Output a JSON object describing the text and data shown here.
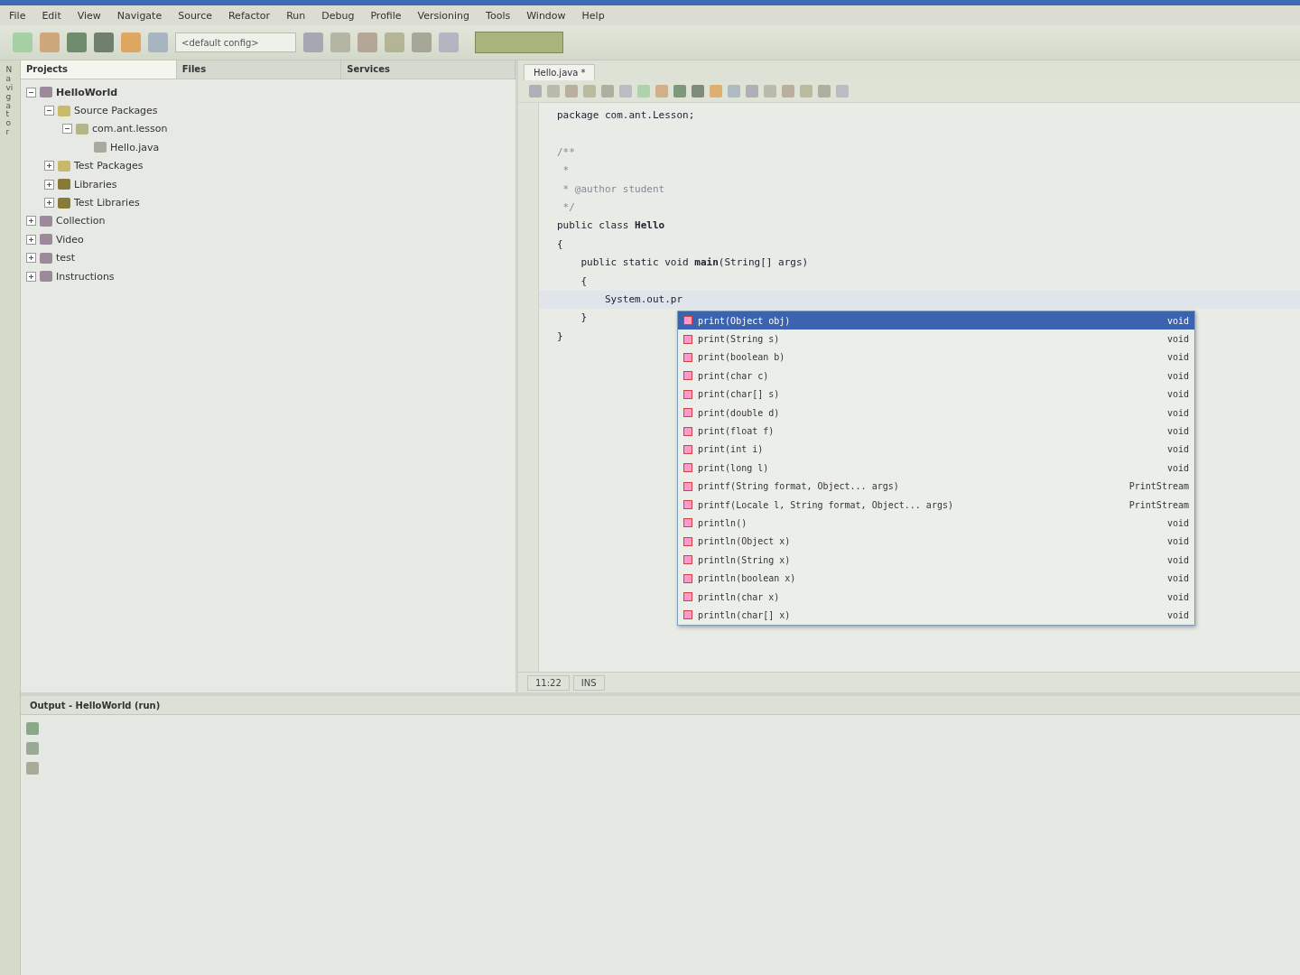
{
  "menu": [
    "File",
    "Edit",
    "View",
    "Navigate",
    "Source",
    "Refactor",
    "Run",
    "Debug",
    "Profile",
    "Versioning",
    "Tools",
    "Window",
    "Help"
  ],
  "toolbar": {
    "config": "<default config>"
  },
  "side_strip": {
    "label": "Navigator"
  },
  "projects_panel": {
    "tabs": [
      {
        "label": "Projects",
        "selected": true
      },
      {
        "label": "Files",
        "selected": false
      },
      {
        "label": "Services",
        "selected": false
      }
    ],
    "tree": [
      {
        "label": "HelloWorld",
        "kind": "project",
        "expanded": true,
        "bold": true,
        "children": [
          {
            "label": "Source Packages",
            "kind": "folder",
            "expanded": true,
            "children": [
              {
                "label": "com.ant.lesson",
                "kind": "package",
                "expanded": true,
                "children": [
                  {
                    "label": "Hello.java",
                    "kind": "file"
                  }
                ]
              }
            ]
          },
          {
            "label": "Test Packages",
            "kind": "folder",
            "expanded": false
          },
          {
            "label": "Libraries",
            "kind": "library",
            "expanded": false
          },
          {
            "label": "Test Libraries",
            "kind": "library",
            "expanded": false
          }
        ]
      },
      {
        "label": "Collection",
        "kind": "project",
        "expanded": false
      },
      {
        "label": "Video",
        "kind": "project",
        "expanded": false
      },
      {
        "label": "test",
        "kind": "project",
        "expanded": false
      },
      {
        "label": "Instructions",
        "kind": "project",
        "expanded": false
      }
    ]
  },
  "editor": {
    "tab": "Hello.java *",
    "lines": [
      {
        "text": "package com.ant.Lesson;",
        "kind": "code"
      },
      {
        "kind": "blank"
      },
      {
        "text": "/**",
        "kind": "comment"
      },
      {
        "text": " *",
        "kind": "comment"
      },
      {
        "text": " * @author student",
        "kind": "comment"
      },
      {
        "text": " */",
        "kind": "comment"
      },
      {
        "text": "public class **Hello**",
        "kind": "code"
      },
      {
        "text": "{",
        "kind": "code"
      },
      {
        "text": "    public static void **main**(String[] args)",
        "kind": "code"
      },
      {
        "text": "    {",
        "kind": "code"
      },
      {
        "text": "        System.out.pr",
        "kind": "current"
      },
      {
        "text": "    }",
        "kind": "code"
      },
      {
        "text": "}",
        "kind": "code"
      }
    ],
    "status": [
      "11:22",
      "INS"
    ]
  },
  "completion": [
    {
      "signature": "print(Object obj)",
      "type": "void",
      "selected": true
    },
    {
      "signature": "print(String s)",
      "type": "void",
      "selected": false
    },
    {
      "signature": "print(boolean b)",
      "type": "void",
      "selected": false
    },
    {
      "signature": "print(char c)",
      "type": "void",
      "selected": false
    },
    {
      "signature": "print(char[] s)",
      "type": "void",
      "selected": false
    },
    {
      "signature": "print(double d)",
      "type": "void",
      "selected": false
    },
    {
      "signature": "print(float f)",
      "type": "void",
      "selected": false
    },
    {
      "signature": "print(int i)",
      "type": "void",
      "selected": false
    },
    {
      "signature": "print(long l)",
      "type": "void",
      "selected": false
    },
    {
      "signature": "printf(String format, Object... args)",
      "type": "PrintStream",
      "selected": false
    },
    {
      "signature": "printf(Locale l, String format, Object... args)",
      "type": "PrintStream",
      "selected": false
    },
    {
      "signature": "println()",
      "type": "void",
      "selected": false
    },
    {
      "signature": "println(Object x)",
      "type": "void",
      "selected": false
    },
    {
      "signature": "println(String x)",
      "type": "void",
      "selected": false
    },
    {
      "signature": "println(boolean x)",
      "type": "void",
      "selected": false
    },
    {
      "signature": "println(char x)",
      "type": "void",
      "selected": false
    },
    {
      "signature": "println(char[] x)",
      "type": "void",
      "selected": false
    }
  ],
  "output": {
    "title": "Output - HelloWorld (run)"
  }
}
